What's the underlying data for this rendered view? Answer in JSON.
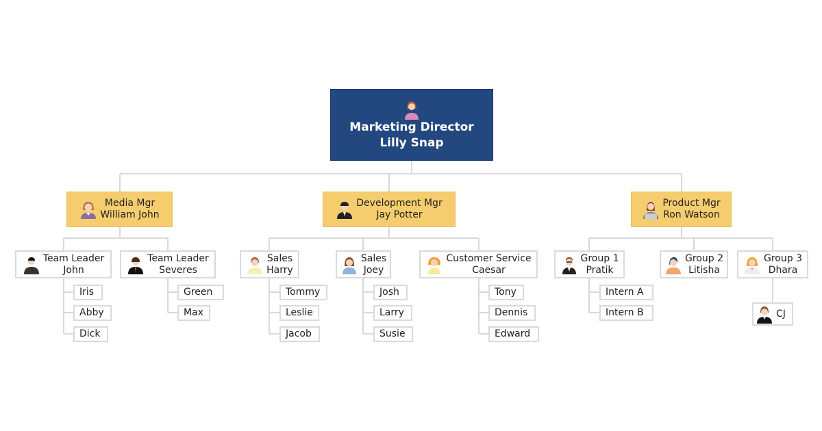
{
  "director": {
    "title": "Marketing Director",
    "name": "Lilly Snap",
    "icon": "woman-avatar-icon"
  },
  "managers": [
    {
      "title": "Media Mgr",
      "name": "William John",
      "icon": "woman-avatar-icon"
    },
    {
      "title": "Development Mgr",
      "name": "Jay Potter",
      "icon": "man-avatar-icon"
    },
    {
      "title": "Product Mgr",
      "name": "Ron Watson",
      "icon": "woman-laptop-avatar-icon"
    }
  ],
  "leads": [
    {
      "title": "Team Leader",
      "name": "John",
      "members": [
        "Iris",
        "Abby",
        "Dick"
      ]
    },
    {
      "title": "Team Leader",
      "name": "Severes",
      "members": [
        "Green",
        "Max"
      ]
    },
    {
      "title": "Sales",
      "name": "Harry",
      "members": [
        "Tommy",
        "Leslie",
        "Jacob"
      ]
    },
    {
      "title": "Sales",
      "name": "Joey",
      "members": [
        "Josh",
        "Larry",
        "Susie"
      ]
    },
    {
      "title": "Customer Service",
      "name": "Caesar",
      "members": [
        "Tony",
        "Dennis",
        "Edward"
      ]
    },
    {
      "title": "Group 1",
      "name": "Pratik",
      "members": [
        "Intern A",
        "Intern B"
      ]
    },
    {
      "title": "Group 2",
      "name": "Litisha",
      "members": []
    },
    {
      "title": "Group 3",
      "name": "Dhara",
      "members": [
        "CJ"
      ]
    }
  ],
  "colors": {
    "director": "#23477f",
    "manager": "#f5cd6e",
    "connector": "#d9d9d9",
    "border": "#dadada"
  }
}
